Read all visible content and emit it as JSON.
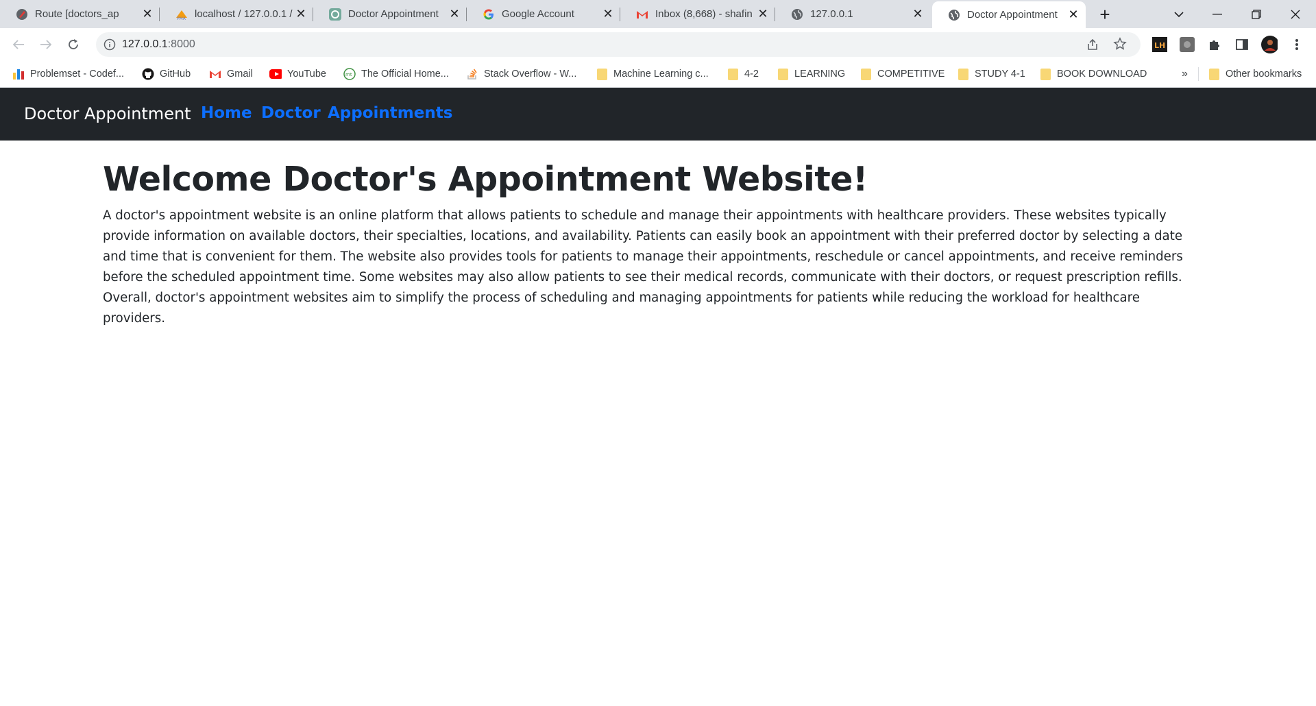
{
  "browser": {
    "tabs": [
      {
        "title": "Route [doctors_ap",
        "icon": "pen-icon"
      },
      {
        "title": "localhost / 127.0.0.1 /",
        "icon": "phpmyadmin-icon"
      },
      {
        "title": "Doctor Appointment",
        "icon": "openai-icon"
      },
      {
        "title": "Google Account",
        "icon": "google-icon"
      },
      {
        "title": "Inbox (8,668) - shafin",
        "icon": "gmail-icon"
      },
      {
        "title": "127.0.0.1",
        "icon": "globe-icon"
      },
      {
        "title": "Doctor Appointment",
        "icon": "globe-icon",
        "active": true
      }
    ],
    "address": {
      "host": "127.0.0.1",
      "port": ":8000"
    },
    "bookmarks": [
      {
        "label": "Problemset - Codef...",
        "icon": "codeforces-icon"
      },
      {
        "label": "GitHub",
        "icon": "github-icon"
      },
      {
        "label": "Gmail",
        "icon": "gmail-icon"
      },
      {
        "label": "YouTube",
        "icon": "youtube-icon"
      },
      {
        "label": "The Official Home...",
        "icon": "mit-icon"
      },
      {
        "label": "Stack Overflow - W...",
        "icon": "stackoverflow-icon"
      },
      {
        "label": "Machine Learning c...",
        "icon": "folder-icon"
      },
      {
        "label": "4-2",
        "icon": "folder-icon"
      },
      {
        "label": "LEARNING",
        "icon": "folder-icon"
      },
      {
        "label": "COMPETITIVE",
        "icon": "folder-icon"
      },
      {
        "label": "STUDY 4-1",
        "icon": "folder-icon"
      },
      {
        "label": "BOOK DOWNLOAD",
        "icon": "folder-icon"
      }
    ],
    "overflow_label": "»",
    "other_bookmarks": "Other bookmarks"
  },
  "site": {
    "brand": "Doctor Appointment",
    "nav": [
      "Home",
      "Doctor",
      "Appointments"
    ],
    "heading": "Welcome Doctor's Appointment Website!",
    "body": "A doctor's appointment website is an online platform that allows patients to schedule and manage their appointments with healthcare providers. These websites typically provide information on available doctors, their specialties, locations, and availability. Patients can easily book an appointment with their preferred doctor by selecting a date and time that is convenient for them. The website also provides tools for patients to manage their appointments, reschedule or cancel appointments, and receive reminders before the scheduled appointment time. Some websites may also allow patients to see their medical records, communicate with their doctors, or request prescription refills. Overall, doctor's appointment websites aim to simplify the process of scheduling and managing appointments for patients while reducing the workload for healthcare providers."
  },
  "colors": {
    "navbar_bg": "#212529",
    "link": "#0d6efd",
    "tabstrip_bg": "#dee1e6"
  }
}
